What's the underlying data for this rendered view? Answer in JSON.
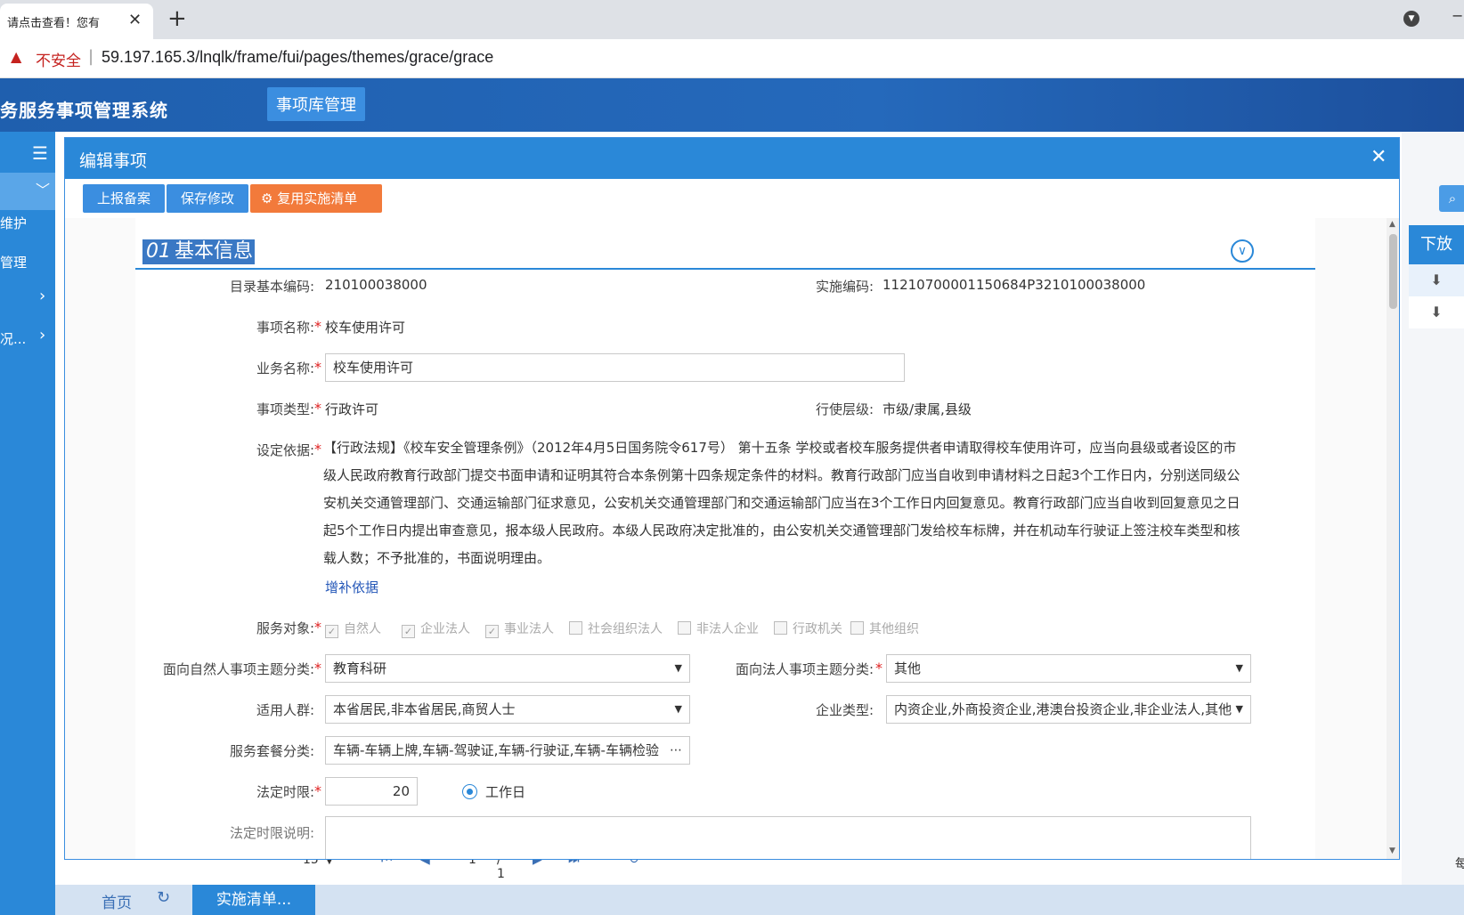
{
  "browser": {
    "tab_title": "请点击查看！您有",
    "tab_close": "✕",
    "new_tab": "+",
    "security_label": "不安全",
    "url": "59.197.165.3/lnqlk/frame/fui/pages/themes/grace/grace"
  },
  "app": {
    "system_title": "务服务事项管理系统",
    "top_nav": "事项库管理"
  },
  "sidebar": {
    "items": [
      {
        "label": "维护"
      },
      {
        "label": "管理"
      },
      {
        "label": "况..."
      }
    ]
  },
  "background": {
    "xiafang": "下放",
    "mei": "每",
    "page_size": "15",
    "page_current": "1",
    "page_total": "/ 1"
  },
  "bottom": {
    "home": "首页",
    "active_tab": "实施清单..."
  },
  "modal": {
    "title": "编辑事项",
    "toolbar": {
      "report": "上报备案",
      "save": "保存修改",
      "reuse": "复用实施清单"
    },
    "section": {
      "num": "01",
      "title": "基本信息"
    },
    "fields": {
      "catalog_code_label": "目录基本编码:",
      "catalog_code": "210100038000",
      "impl_code_label": "实施编码:",
      "impl_code": "11210700001150684P3210100038000",
      "item_name_label": "事项名称:",
      "item_name": "校车使用许可",
      "biz_name_label": "业务名称:",
      "biz_name": "校车使用许可",
      "item_type_label": "事项类型:",
      "item_type": "行政许可",
      "level_label": "行使层级:",
      "level": "市级/隶属,县级",
      "basis_label": "设定依据:",
      "basis_text": "【行政法规】《校车安全管理条例》（2012年4月5日国务院令617号） 第十五条 学校或者校车服务提供者申请取得校车使用许可，应当向县级或者设区的市级人民政府教育行政部门提交书面申请和证明其符合本条例第十四条规定条件的材料。教育行政部门应当自收到申请材料之日起3个工作日内，分别送同级公安机关交通管理部门、交通运输部门征求意见，公安机关交通管理部门和交通运输部门应当在3个工作日内回复意见。教育行政部门应当自收到回复意见之日起5个工作日内提出审查意见，报本级人民政府。本级人民政府决定批准的，由公安机关交通管理部门发给校车标牌，并在机动车行驶证上签注校车类型和核载人数；不予批准的，书面说明理由。",
      "add_basis": "增补依据",
      "service_target_label": "服务对象:",
      "service_targets": [
        {
          "label": "自然人",
          "checked": "✓"
        },
        {
          "label": "企业法人",
          "checked": "✓"
        },
        {
          "label": "事业法人",
          "checked": "✓"
        },
        {
          "label": "社会组织法人",
          "checked": ""
        },
        {
          "label": "非法人企业",
          "checked": ""
        },
        {
          "label": "行政机关",
          "checked": ""
        },
        {
          "label": "其他组织",
          "checked": ""
        }
      ],
      "natural_theme_label": "面向自然人事项主题分类:",
      "natural_theme": "教育科研",
      "legal_theme_label": "面向法人事项主题分类:",
      "legal_theme": "其他",
      "crowd_label": "适用人群:",
      "crowd": "本省居民,非本省居民,商贸人士",
      "ent_type_label": "企业类型:",
      "ent_type": "内资企业,外商投资企业,港澳台投资企业,非企业法人,其他",
      "package_label": "服务套餐分类:",
      "package": "车辆-车辆上牌,车辆-驾驶证,车辆-行驶证,车辆-车辆检验",
      "legal_limit_label": "法定时限:",
      "legal_limit": "20",
      "workday": "工作日",
      "limit_desc_label": "法定时限说明:"
    }
  }
}
